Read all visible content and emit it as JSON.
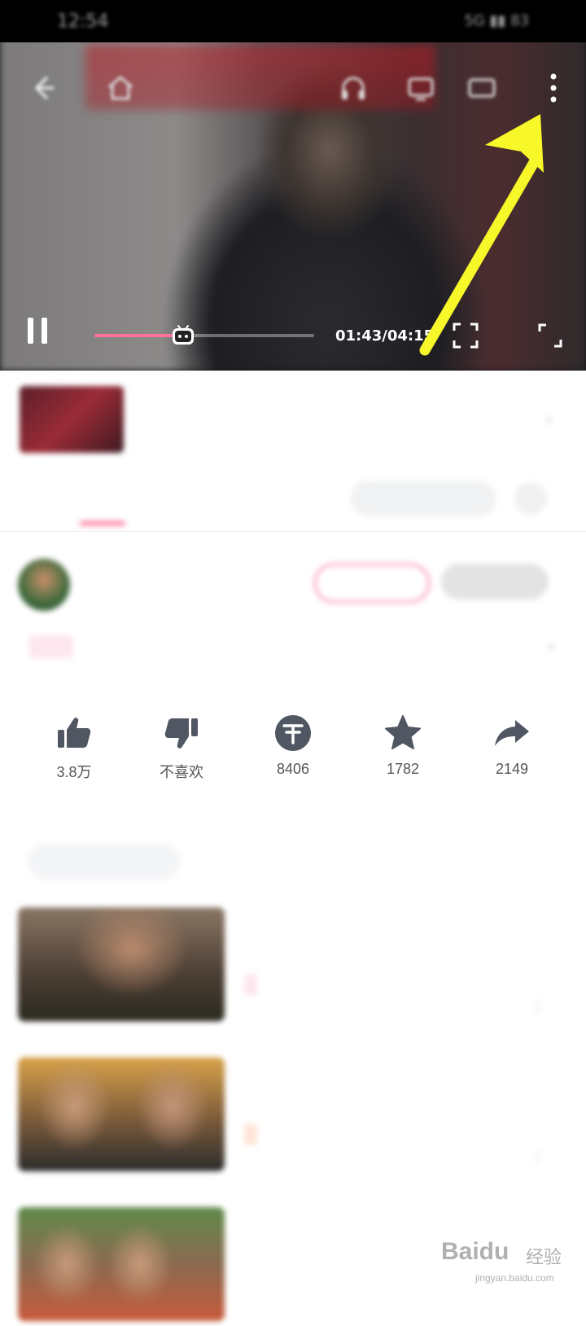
{
  "status_bar": {
    "time": "12:54",
    "right": "5G ▮▮ 83"
  },
  "player": {
    "current_time": "01:43",
    "duration": "04:15",
    "time_display": "01:43/04:15",
    "progress_fraction": 0.404,
    "accent_color": "#fb7299",
    "arrow_color": "#f7f72a",
    "icons": [
      "back-icon",
      "home-icon",
      "headphone-icon",
      "cast-icon",
      "tv-icon",
      "more-icon",
      "pause-icon",
      "crop-icon",
      "fullscreen-icon"
    ]
  },
  "collection": {
    "title": "",
    "subtitle": "",
    "more": ""
  },
  "tabs": {
    "intro": "",
    "comments": "",
    "danmaku_placeholder": ""
  },
  "uploader": {
    "name": "",
    "stats": "",
    "follow": "",
    "charge": ""
  },
  "video": {
    "badge": "",
    "title": "",
    "meta": ""
  },
  "actions": [
    {
      "name": "like",
      "label": "3.8万",
      "icon": "thumb-up-icon"
    },
    {
      "name": "dislike",
      "label": "不喜欢",
      "icon": "thumb-down-icon"
    },
    {
      "name": "coin",
      "label": "8406",
      "icon": "coin-icon"
    },
    {
      "name": "favorite",
      "label": "1782",
      "icon": "star-icon"
    },
    {
      "name": "share",
      "label": "2149",
      "icon": "share-icon"
    }
  ],
  "tag_chip": "",
  "recommendations": [
    {
      "title": "",
      "tag": "",
      "author": "",
      "stats": "",
      "score": "",
      "score_sub": ""
    },
    {
      "title": "",
      "tag": "",
      "author": "",
      "stats": ""
    },
    {
      "title": "",
      "tag": "",
      "author": "",
      "stats": ""
    }
  ],
  "watermark": {
    "brand": "Baidu",
    "cn": "经验",
    "url": "jingyan.baidu.com"
  }
}
